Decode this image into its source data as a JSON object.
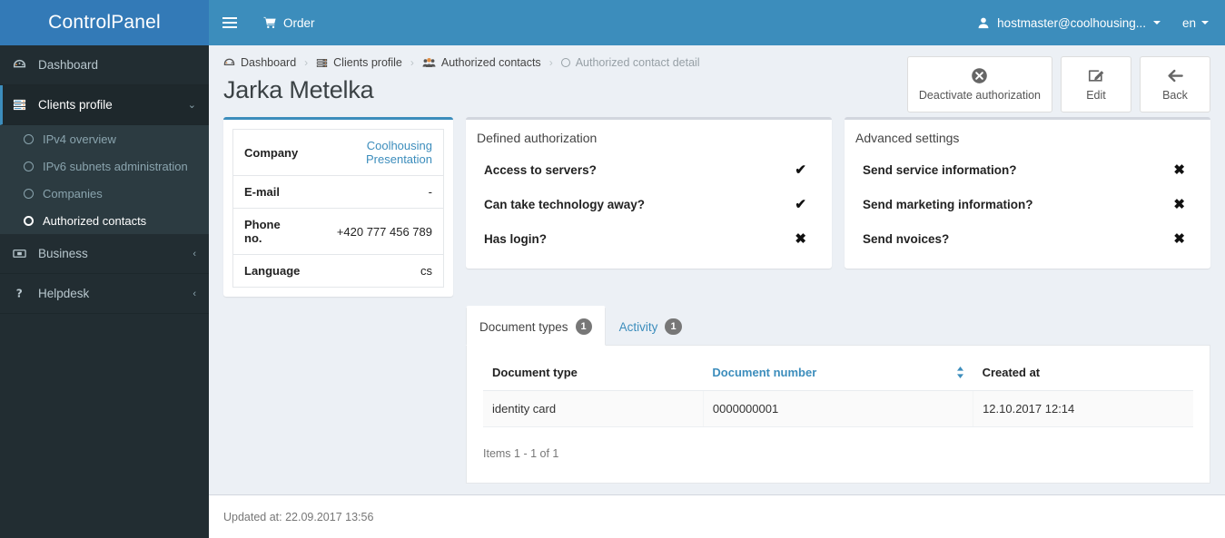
{
  "brand": {
    "title": "ControlPanel"
  },
  "navbar": {
    "menu_toggle": "menu-toggle",
    "order_label": "Order",
    "user_label": "hostmaster@coolhousing...",
    "lang_label": "en"
  },
  "sidebar": {
    "items": [
      {
        "label": "Dashboard",
        "icon": "dashboard-icon",
        "active": false
      },
      {
        "label": "Clients profile",
        "icon": "server-stack-icon",
        "active": true,
        "caret": "⌄"
      },
      {
        "label": "Business",
        "icon": "money-icon",
        "active": false,
        "caret": "‹"
      },
      {
        "label": "Helpdesk",
        "icon": "question-icon",
        "active": false,
        "caret": "‹"
      }
    ],
    "subitems": [
      {
        "label": "IPv4 overview",
        "active": false
      },
      {
        "label": "IPv6 subnets administration",
        "active": false
      },
      {
        "label": "Companies",
        "active": false
      },
      {
        "label": "Authorized contacts",
        "active": true
      }
    ]
  },
  "breadcrumb": {
    "items": [
      {
        "label": "Dashboard",
        "icon": "dashboard-icon"
      },
      {
        "label": "Clients profile",
        "icon": "server-stack-icon"
      },
      {
        "label": "Authorized contacts",
        "icon": "users-icon"
      },
      {
        "label": "Authorized contact detail",
        "icon": "ring-icon"
      }
    ],
    "separator": "›"
  },
  "page": {
    "title": "Jarka Metelka"
  },
  "actions": [
    {
      "label": "Deactivate authorization",
      "icon": "times-circle-icon"
    },
    {
      "label": "Edit",
      "icon": "pencil-square-icon"
    },
    {
      "label": "Back",
      "icon": "arrow-left-icon"
    }
  ],
  "info_card": {
    "rows": [
      {
        "key": "Company",
        "value": "Coolhousing Presentation",
        "link": true
      },
      {
        "key": "E-mail",
        "value": "-",
        "link": false
      },
      {
        "key": "Phone no.",
        "value": "+420 777 456 789",
        "link": false
      },
      {
        "key": "Language",
        "value": "cs",
        "link": false
      }
    ]
  },
  "defined_authorization": {
    "title": "Defined authorization",
    "rows": [
      {
        "label": "Access to servers?",
        "mark": "✔"
      },
      {
        "label": "Can take technology away?",
        "mark": "✔"
      },
      {
        "label": "Has login?",
        "mark": "✖"
      }
    ]
  },
  "advanced_settings": {
    "title": "Advanced settings",
    "rows": [
      {
        "label": "Send service information?",
        "mark": "✖"
      },
      {
        "label": "Send marketing information?",
        "mark": "✖"
      },
      {
        "label": "Send nvoices?",
        "mark": "✖"
      }
    ]
  },
  "tabs": [
    {
      "label": "Document types",
      "count": "1",
      "active": true
    },
    {
      "label": "Activity",
      "count": "1",
      "active": false
    }
  ],
  "documents_table": {
    "columns": [
      {
        "label": "Document type",
        "sortable": false
      },
      {
        "label": "Document number",
        "sortable": true
      },
      {
        "label": "Created at",
        "sortable": false
      }
    ],
    "rows": [
      {
        "type": "identity card",
        "number": "0000000001",
        "created_at": "12.10.2017 12:14"
      }
    ],
    "items_info": "Items 1 - 1 of 1"
  },
  "footer": {
    "updated_at": "Updated at: 22.09.2017 13:56"
  },
  "colors": {
    "header_blue": "#3c8dbc",
    "sidebar_dark": "#222d32",
    "sidebar_sub": "#2c3b41",
    "content_bg": "#ecf0f5",
    "link_blue": "#3c8dbc"
  }
}
